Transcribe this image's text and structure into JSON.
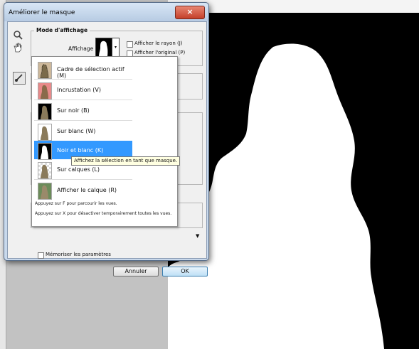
{
  "dialog": {
    "title": "Améliorer le masque",
    "close_icon": "×",
    "view_group": {
      "legend": "Mode d'affichage",
      "view_label": "Affichage :",
      "show_radius_label": "Afficher le rayon (J)",
      "show_original_label": "Afficher l'original (P)"
    },
    "remember_label": "Mémoriser les paramètres",
    "cancel_label": "Annuler",
    "ok_label": "OK"
  },
  "popup": {
    "items": [
      {
        "label": "Cadre de sélection actif (M)",
        "icon": "marching-ants-thumb"
      },
      {
        "label": "Incrustation (V)",
        "icon": "overlay-thumb"
      },
      {
        "label": "Sur noir (B)",
        "icon": "on-black-thumb"
      },
      {
        "label": "Sur blanc (W)",
        "icon": "on-white-thumb"
      },
      {
        "label": "Noir et blanc (K)",
        "icon": "black-white-thumb"
      },
      {
        "label": "Sur calques (L)",
        "icon": "on-layers-thumb"
      },
      {
        "label": "Afficher le calque (R)",
        "icon": "reveal-layer-thumb"
      }
    ],
    "help_line1": "Appuyez sur F pour parcourir les vues.",
    "help_line2": "Appuyez sur X pour désactiver temporairement toutes les vues."
  },
  "tooltip": "Affichez la sélection en tant que masque.",
  "colors": {
    "selection_accent": "#3399ff",
    "canvas_bg": "#000000",
    "mask_fill": "#ffffff"
  }
}
